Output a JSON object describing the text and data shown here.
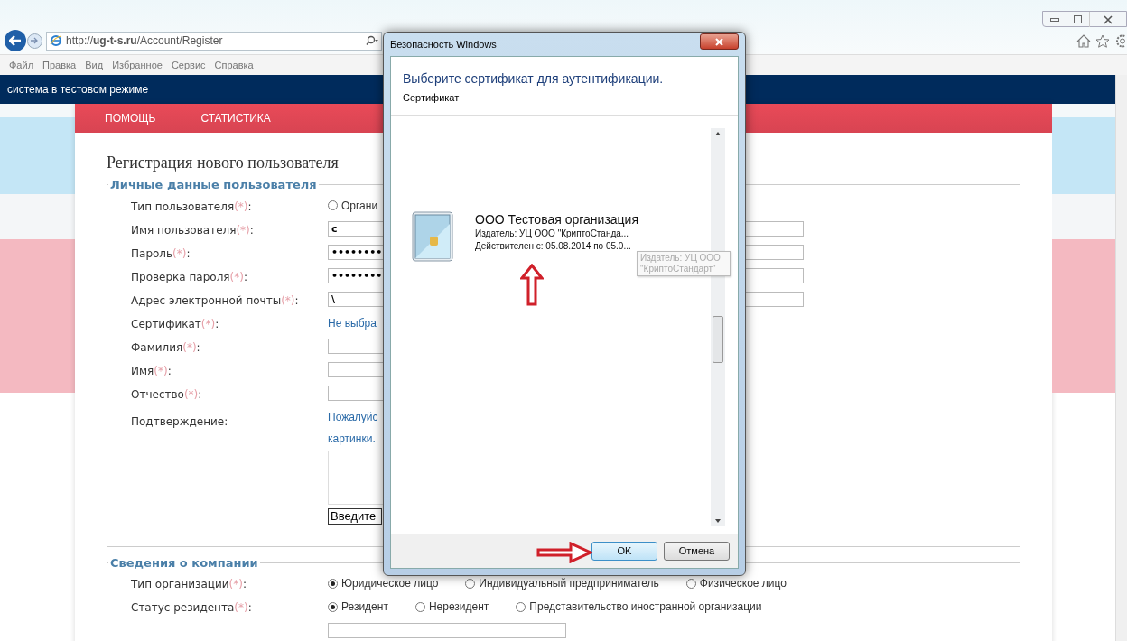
{
  "browser": {
    "address": "http://**ug-t-s.ru**/Account/Register",
    "menu": [
      "Файл",
      "Правка",
      "Вид",
      "Избранное",
      "Сервис",
      "Справка"
    ]
  },
  "site": {
    "banner": "система в тестовом режиме",
    "nav": [
      "ПОМОЩЬ",
      "СТАТИСТИКА"
    ]
  },
  "form": {
    "title": "Регистрация нового пользователя",
    "personal": {
      "legend": "Личные данные пользователя",
      "rows": [
        {
          "kind": "radio",
          "label": "Тип пользователя",
          "required_mark": "(*)",
          "suffix": ":",
          "options": [
            {
              "label": "Органи",
              "selected": false
            }
          ]
        },
        {
          "kind": "wide_input",
          "label": "Имя пользователя",
          "required_mark": "(*)",
          "suffix": ":",
          "value": "с"
        },
        {
          "kind": "wide_input",
          "label": "Пароль",
          "required_mark": "(*)",
          "suffix": ":",
          "value": "••••••••"
        },
        {
          "kind": "wide_input",
          "label": "Проверка пароля",
          "required_mark": "(*)",
          "suffix": ":",
          "value": "••••••••"
        },
        {
          "kind": "wide_input",
          "label": "Адрес электронной почты",
          "required_mark": "(*)",
          "suffix": ":",
          "value": "\\"
        },
        {
          "kind": "link",
          "label": "Сертификат",
          "required_mark": "(*)",
          "suffix": ":",
          "text": "Не выбра"
        },
        {
          "kind": "input",
          "label": "Фамилия",
          "required_mark": "(*)",
          "suffix": ":"
        },
        {
          "kind": "input",
          "label": "Имя",
          "required_mark": "(*)",
          "suffix": ":"
        },
        {
          "kind": "input",
          "label": "Отчество",
          "required_mark": "(*)",
          "suffix": ":"
        },
        {
          "kind": "captcha",
          "label": "Подтверждение",
          "suffix": ":",
          "text_1": "Пожалуйс",
          "text_2": "картинки.",
          "input_value": "Введите"
        }
      ]
    },
    "company": {
      "legend": "Сведения о компании",
      "rows": [
        {
          "kind": "radio",
          "label": "Тип организации",
          "required_mark": "(*)",
          "suffix": ":",
          "options": [
            {
              "label": "Юридическое лицо",
              "selected": true
            },
            {
              "label": "Индивидуальный предприниматель",
              "selected": false
            },
            {
              "label": "Физическое лицо",
              "selected": false
            }
          ]
        },
        {
          "kind": "radio",
          "label": "Статус резидента",
          "required_mark": "(*)",
          "suffix": ":",
          "options": [
            {
              "label": "Резидент",
              "selected": true
            },
            {
              "label": "Нерезидент",
              "selected": false
            },
            {
              "label": "Представительство иностранной организации",
              "selected": false
            }
          ]
        }
      ]
    }
  },
  "dialog": {
    "title": "Безопасность Windows",
    "heading": "Выберите сертификат для аутентификации.",
    "subheading": "Сертификат",
    "certificate": {
      "name": "ООО Тестовая организация",
      "issuer": "Издатель: УЦ ООО \"КриптоСтанда...",
      "valid": "Действителен с: 05.08.2014 по 05.0..."
    },
    "tooltip": "Издатель: УЦ ООО \"КриптоСтандарт\"",
    "buttons": [
      {
        "label": "OK",
        "default": true
      },
      {
        "label": "Отмена",
        "default": false
      }
    ]
  }
}
